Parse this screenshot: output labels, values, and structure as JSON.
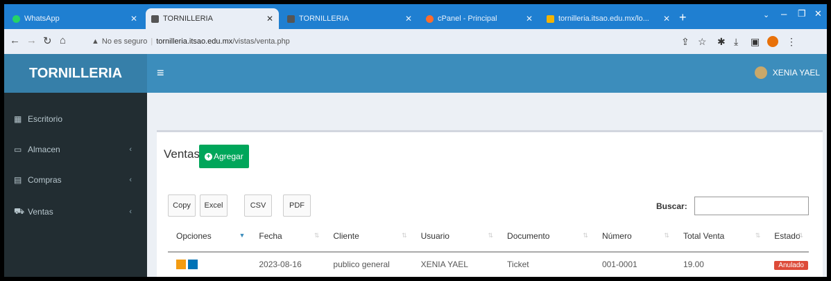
{
  "browser": {
    "tabs": [
      {
        "title": "WhatsApp",
        "favicon_color": "#25d366"
      },
      {
        "title": "TORNILLERIA",
        "favicon_color": "#555555"
      },
      {
        "title": "TORNILLERIA",
        "favicon_color": "#555555"
      },
      {
        "title": "cPanel - Principal",
        "favicon_color": "#ff6c2c"
      },
      {
        "title": "tornilleria.itsao.edu.mx/lo...",
        "favicon_color": "#f4b400"
      }
    ],
    "active_tab_index": 1,
    "address": {
      "security": "No es seguro",
      "host": "tornilleria.itsao.edu.mx",
      "path": "/vistas/venta.php"
    }
  },
  "app": {
    "brand": "TORNILLERIA",
    "user_name": "XENIA YAEL",
    "sidebar": [
      {
        "label": "Escritorio",
        "icon": "dashboard-icon",
        "has_submenu": false
      },
      {
        "label": "Almacen",
        "icon": "laptop-icon",
        "has_submenu": true
      },
      {
        "label": "Compras",
        "icon": "th-icon",
        "has_submenu": true
      },
      {
        "label": "Ventas",
        "icon": "cart-icon",
        "has_submenu": true
      }
    ]
  },
  "content": {
    "title": "Ventas",
    "add_button": "Agregar",
    "export_buttons": [
      "Copy",
      "Excel",
      "CSV",
      "PDF"
    ],
    "search_label": "Buscar:",
    "search_value": "",
    "table": {
      "headers": [
        "Opciones",
        "Fecha",
        "Cliente",
        "Usuario",
        "Documento",
        "Número",
        "Total Venta",
        "Estado"
      ],
      "rows": [
        {
          "fecha": "2023-08-16",
          "cliente": "publico general",
          "usuario": "XENIA YAEL",
          "documento": "Ticket",
          "numero": "001-0001",
          "total": "19.00",
          "estado": "Anulado"
        }
      ]
    }
  },
  "colors": {
    "tab_bar": "#1f7fd1",
    "header": "#3c8dbc",
    "brand_bg": "#367fa9",
    "sidebar": "#222d32",
    "add_button": "#00a65a",
    "status_badge": "#dd4b39"
  }
}
